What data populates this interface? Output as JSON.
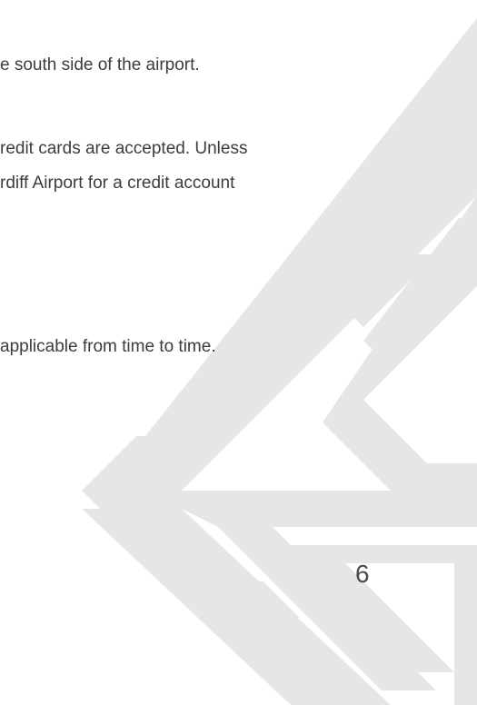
{
  "page": {
    "lines": [
      "e south side of the airport.",
      "redit cards are accepted. Unless",
      "rdiff Airport for a credit account",
      " applicable from time to time."
    ],
    "page_number": "6"
  },
  "watermark": {
    "icon": "chevron-pattern-watermark",
    "color": "#e6e6e6"
  }
}
